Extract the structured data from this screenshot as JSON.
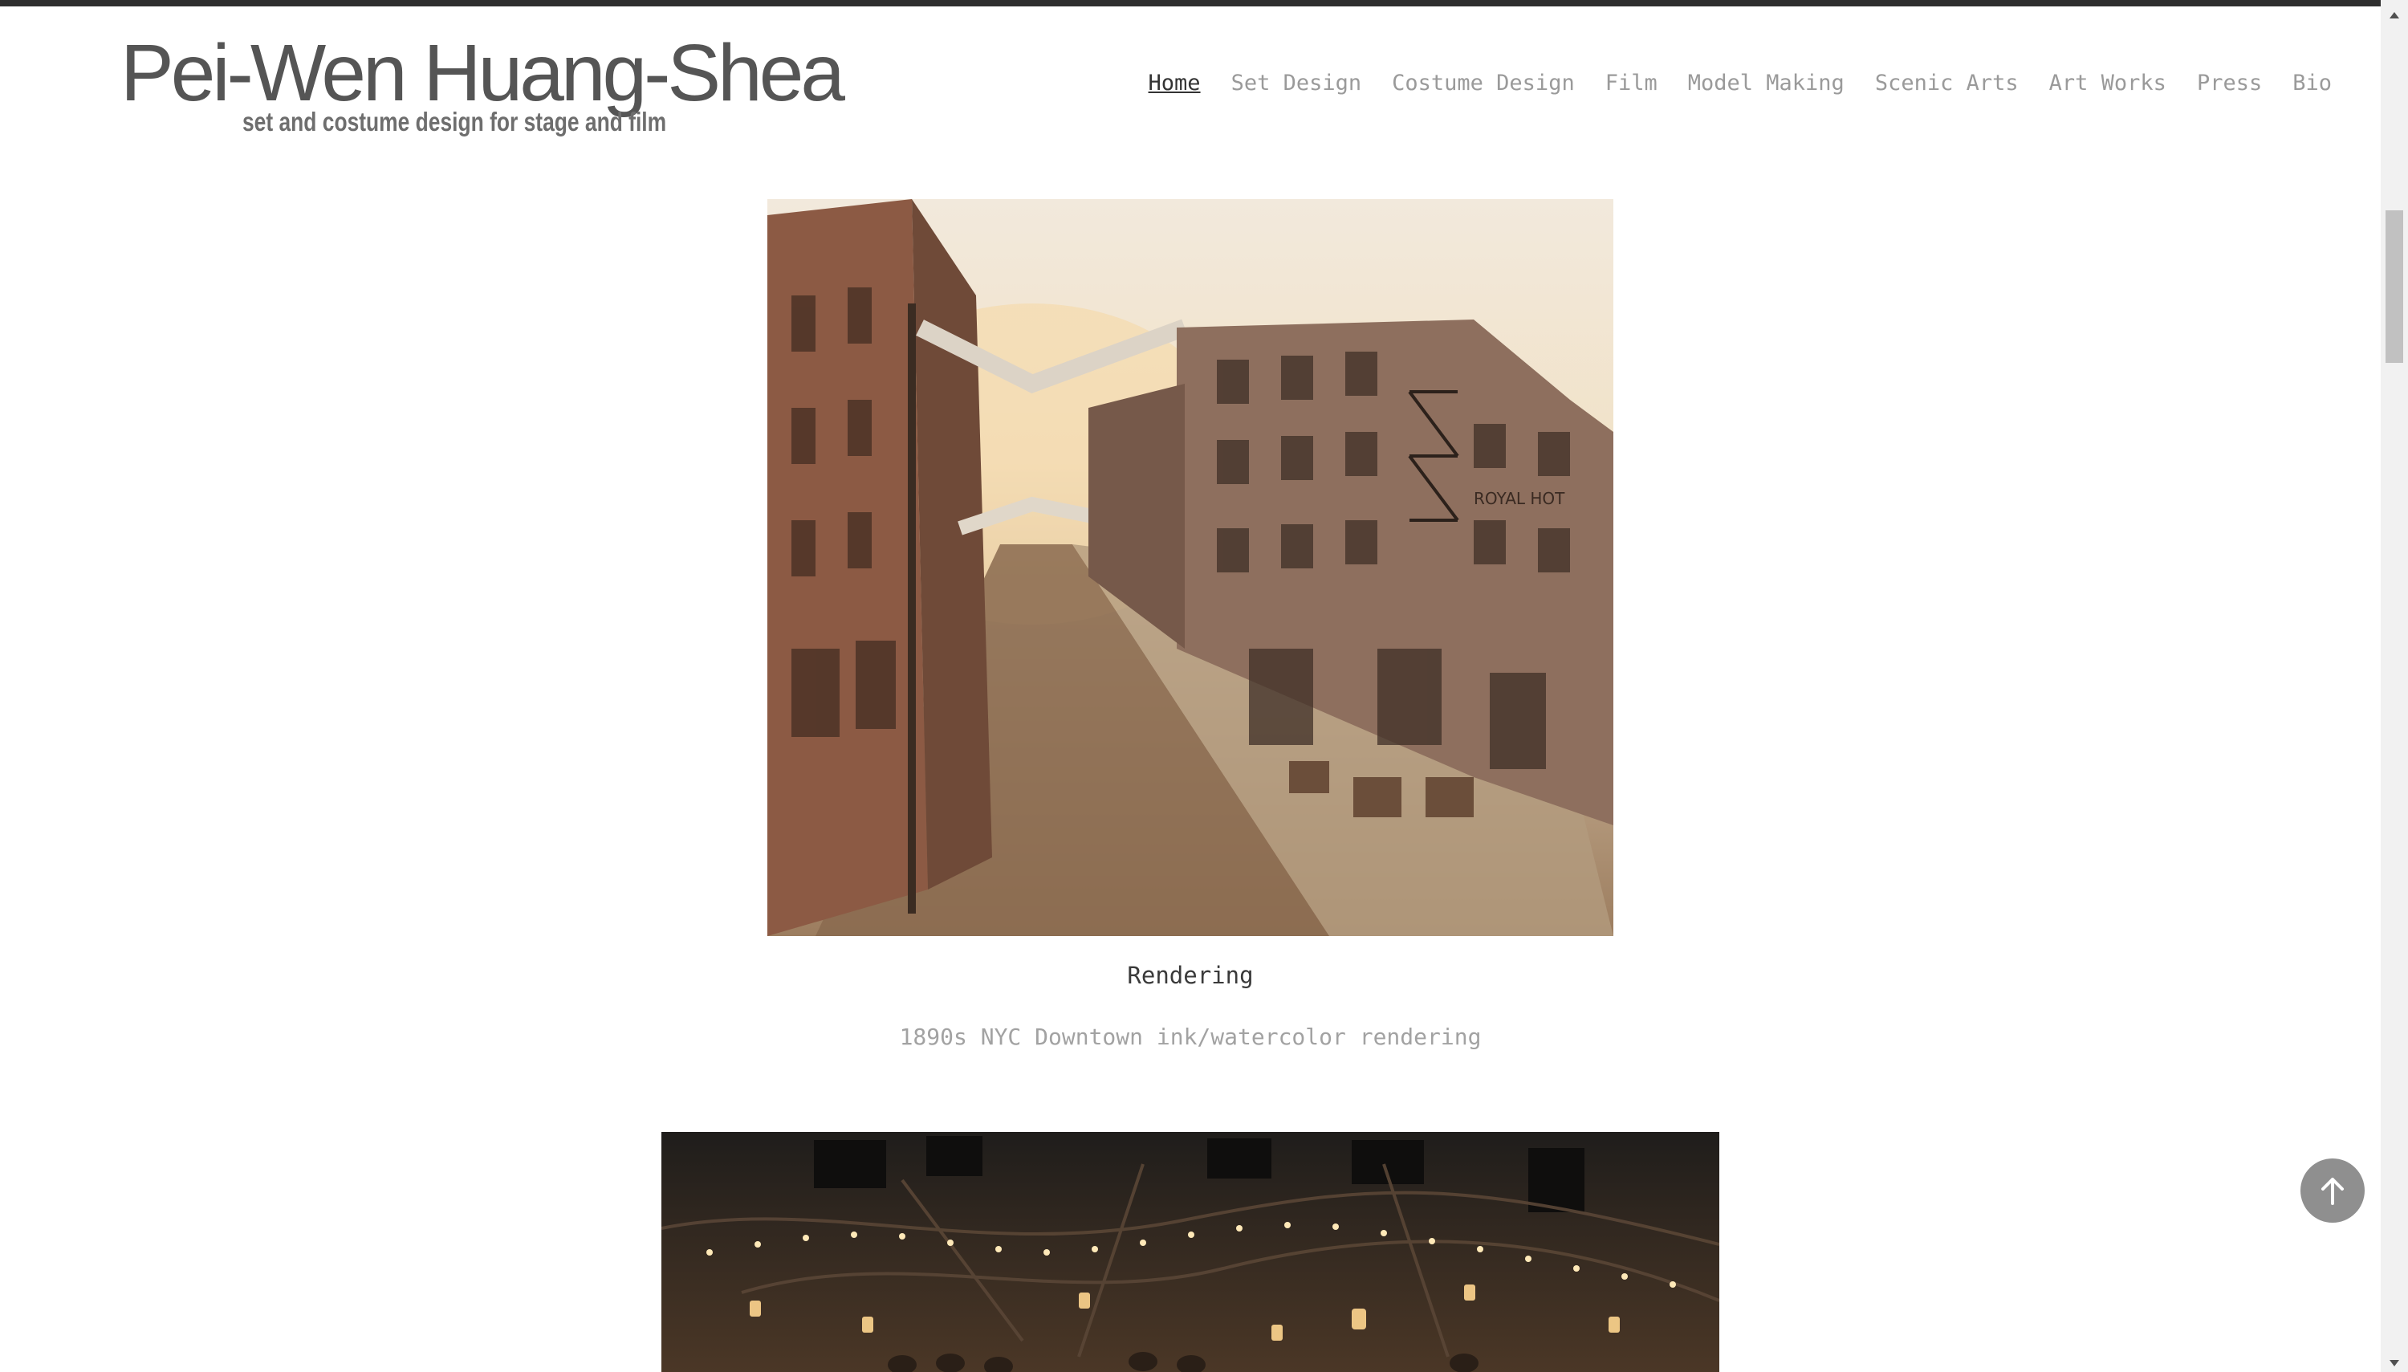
{
  "site": {
    "name": "Pei-Wen Huang-Shea",
    "tagline": "set and costume design for stage and film"
  },
  "nav": {
    "items": [
      {
        "label": "Home",
        "active": true
      },
      {
        "label": "Set Design",
        "active": false
      },
      {
        "label": "Costume Design",
        "active": false
      },
      {
        "label": "Film",
        "active": false
      },
      {
        "label": "Model Making",
        "active": false
      },
      {
        "label": "Scenic Arts",
        "active": false
      },
      {
        "label": "Art Works",
        "active": false
      },
      {
        "label": "Press",
        "active": false
      },
      {
        "label": "Bio",
        "active": false
      }
    ]
  },
  "gallery": {
    "items": [
      {
        "title": "Rendering",
        "description": "1890s NYC Downtown ink/watercolor rendering",
        "image_alt": "1890s NYC Downtown ink/watercolor rendering"
      },
      {
        "image_alt": "Theater interior with hanging lanterns and string lights"
      }
    ]
  },
  "controls": {
    "scroll_top_icon": "arrow-up-icon"
  },
  "colors": {
    "topbar": "#2e2e2e",
    "nav_inactive": "#9a9a9a",
    "nav_active": "#333333",
    "scroll_button": "#8f8f8f"
  }
}
